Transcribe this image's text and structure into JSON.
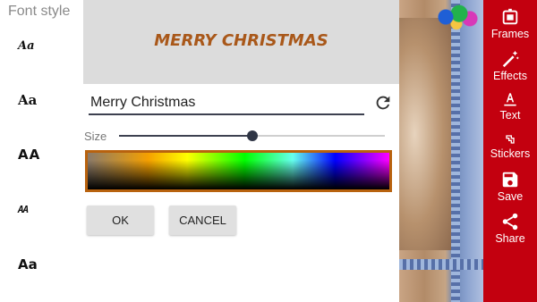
{
  "font_panel": {
    "title": "Font style",
    "items": [
      {
        "label": "Aa"
      },
      {
        "label": "Aa"
      },
      {
        "label": "AA"
      },
      {
        "label": "AA"
      },
      {
        "label": "Aa"
      }
    ]
  },
  "dialog": {
    "preview_text": "MERRY CHRISTMAS",
    "preview_color": "#a9581a",
    "text_input_value": "Merry Christmas",
    "size_label": "Size",
    "size_value": 0.5,
    "ok_label": "OK",
    "cancel_label": "CANCEL",
    "picker_border_color": "#b8620e"
  },
  "toolbar": {
    "background": "#c3000f",
    "items": [
      {
        "label": "Frames",
        "icon": "frames-icon"
      },
      {
        "label": "Effects",
        "icon": "magic-wand-icon"
      },
      {
        "label": "Text",
        "icon": "text-icon"
      },
      {
        "label": "Stickers",
        "icon": "stickers-icon"
      },
      {
        "label": "Save",
        "icon": "save-icon"
      },
      {
        "label": "Share",
        "icon": "share-icon"
      }
    ]
  }
}
